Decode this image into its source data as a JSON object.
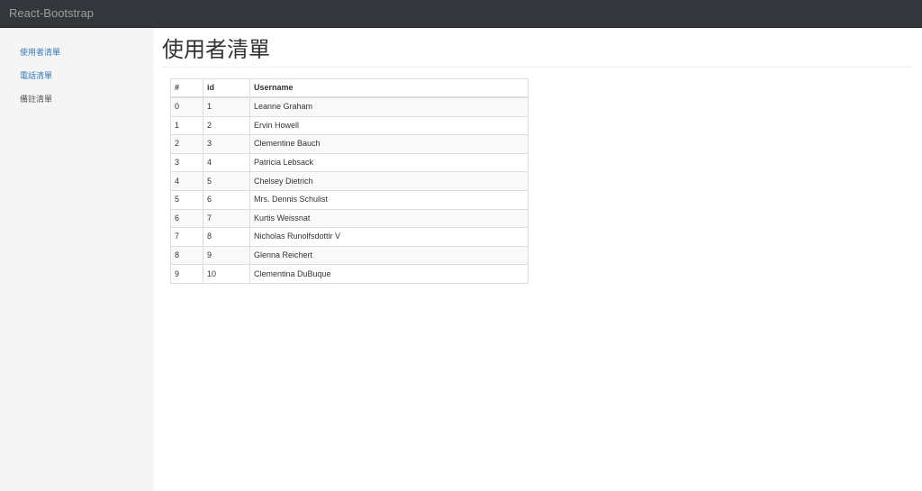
{
  "navbar": {
    "brand": "React-Bootstrap"
  },
  "sidebar": {
    "items": [
      {
        "label": "使用者清單",
        "active_link": true
      },
      {
        "label": "電話清單",
        "active_link": true
      },
      {
        "label": "備註清單",
        "active_link": false
      }
    ]
  },
  "main": {
    "title": "使用者清單",
    "table": {
      "headers": [
        "#",
        "id",
        "Username"
      ],
      "rows": [
        [
          "0",
          "1",
          "Leanne Graham"
        ],
        [
          "1",
          "2",
          "Ervin Howell"
        ],
        [
          "2",
          "3",
          "Clementine Bauch"
        ],
        [
          "3",
          "4",
          "Patricia Lebsack"
        ],
        [
          "4",
          "5",
          "Chelsey Dietrich"
        ],
        [
          "5",
          "6",
          "Mrs. Dennis Schulist"
        ],
        [
          "6",
          "7",
          "Kurtis Weissnat"
        ],
        [
          "7",
          "8",
          "Nicholas Runolfsdottir V"
        ],
        [
          "8",
          "9",
          "Glenna Reichert"
        ],
        [
          "9",
          "10",
          "Clementina DuBuque"
        ]
      ]
    }
  },
  "colors": {
    "navbar_bg": "#33363b",
    "brand_text": "#9d9d9d",
    "link": "#337ab7",
    "sidebar_bg": "#f5f5f5"
  }
}
